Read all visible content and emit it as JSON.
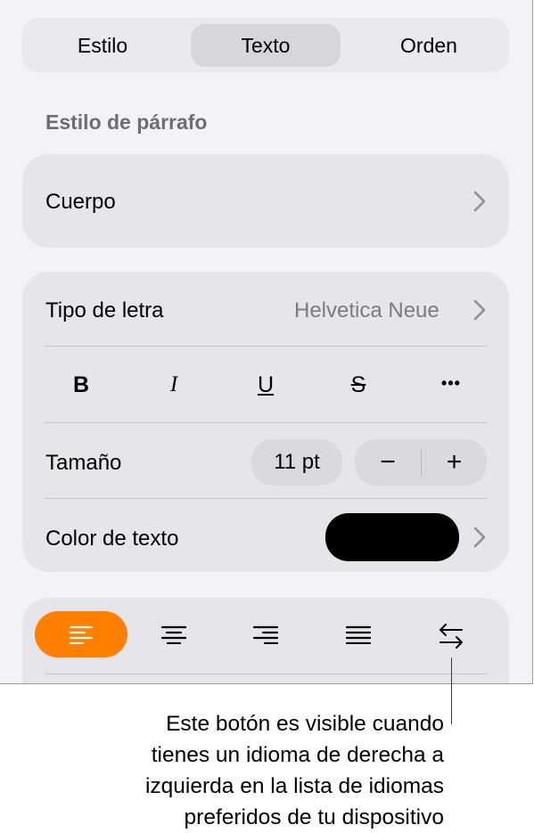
{
  "tabs": [
    {
      "label": "Estilo",
      "active": false
    },
    {
      "label": "Texto",
      "active": true
    },
    {
      "label": "Orden",
      "active": false
    }
  ],
  "paragraph_style": {
    "section_title": "Estilo de párrafo",
    "value": "Cuerpo"
  },
  "font": {
    "label": "Tipo de letra",
    "value": "Helvetica Neue"
  },
  "format_buttons": [
    {
      "label": "B",
      "icon": "bold-icon"
    },
    {
      "label": "I",
      "icon": "italic-icon"
    },
    {
      "label": "U",
      "icon": "underline-icon"
    },
    {
      "label": "S",
      "icon": "strikethrough-icon"
    },
    {
      "label": "•••",
      "icon": "more-icon"
    }
  ],
  "size": {
    "label": "Tamaño",
    "value": "11 pt",
    "decrement": "−",
    "increment": "+"
  },
  "text_color": {
    "label": "Color de texto",
    "color": "#000000"
  },
  "alignment": {
    "selected": "left",
    "options": [
      "align-left-icon",
      "align-center-icon",
      "align-right-icon",
      "justify-icon",
      "text-direction-icon"
    ],
    "accent_color": "#ff8000"
  },
  "callout": {
    "lines": [
      "Este botón es visible cuando",
      "tienes un idioma de derecha a",
      "izquierda en la lista de idiomas",
      "preferidos de tu dispositivo"
    ]
  }
}
